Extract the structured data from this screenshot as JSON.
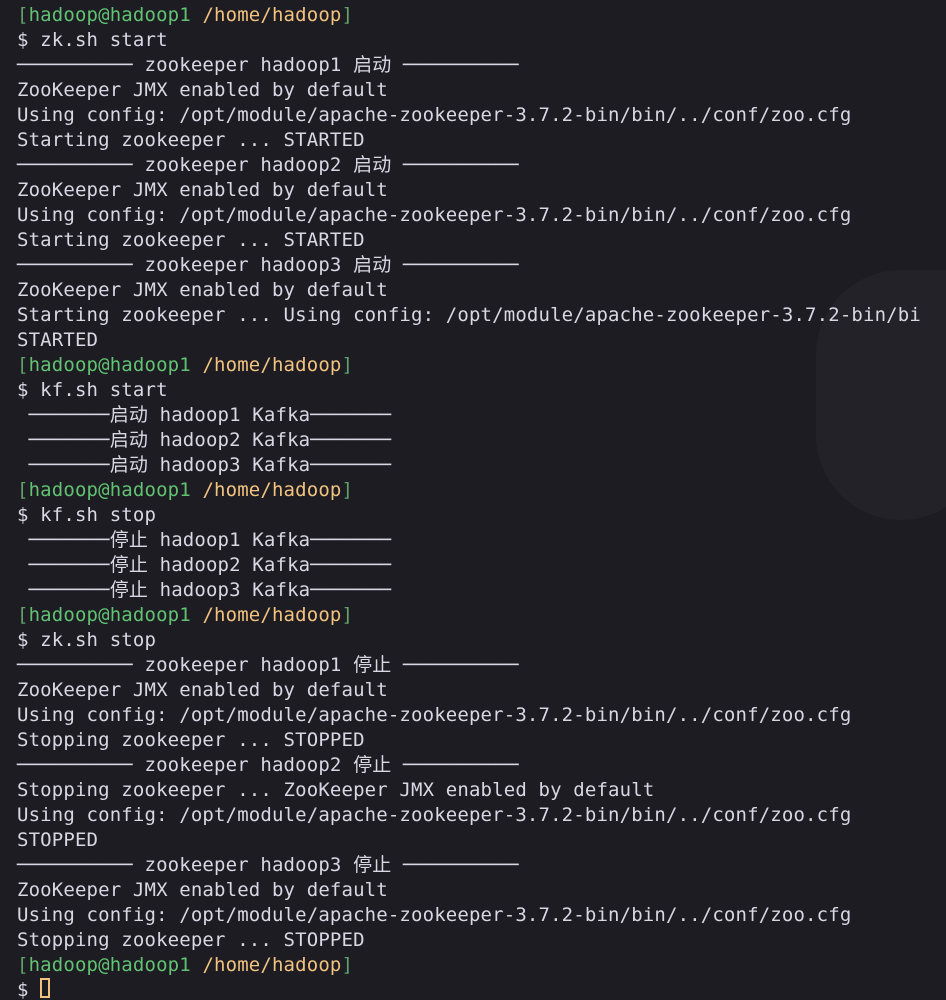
{
  "terminal": {
    "lines": [
      {
        "type": "prompt",
        "bracket_open": "[",
        "user": "hadoop@hadoop1",
        "path": "/home/hadoop",
        "bracket_close": "]"
      },
      {
        "type": "text",
        "text": "$ zk.sh start"
      },
      {
        "type": "text",
        "text": "────────── zookeeper hadoop1 启动 ──────────"
      },
      {
        "type": "text",
        "text": "ZooKeeper JMX enabled by default"
      },
      {
        "type": "text",
        "text": "Using config: /opt/module/apache-zookeeper-3.7.2-bin/bin/../conf/zoo.cfg"
      },
      {
        "type": "text",
        "text": "Starting zookeeper ... STARTED"
      },
      {
        "type": "text",
        "text": "────────── zookeeper hadoop2 启动 ──────────"
      },
      {
        "type": "text",
        "text": "ZooKeeper JMX enabled by default"
      },
      {
        "type": "text",
        "text": "Using config: /opt/module/apache-zookeeper-3.7.2-bin/bin/../conf/zoo.cfg"
      },
      {
        "type": "text",
        "text": "Starting zookeeper ... STARTED"
      },
      {
        "type": "text",
        "text": "────────── zookeeper hadoop3 启动 ──────────"
      },
      {
        "type": "text",
        "text": "ZooKeeper JMX enabled by default"
      },
      {
        "type": "text",
        "text": "Starting zookeeper ... Using config: /opt/module/apache-zookeeper-3.7.2-bin/bi"
      },
      {
        "type": "text",
        "text": "STARTED"
      },
      {
        "type": "prompt",
        "bracket_open": "[",
        "user": "hadoop@hadoop1",
        "path": "/home/hadoop",
        "bracket_close": "]"
      },
      {
        "type": "text",
        "text": "$ kf.sh start"
      },
      {
        "type": "text",
        "text": " ───────启动 hadoop1 Kafka───────"
      },
      {
        "type": "text",
        "text": " ───────启动 hadoop2 Kafka───────"
      },
      {
        "type": "text",
        "text": " ───────启动 hadoop3 Kafka───────"
      },
      {
        "type": "prompt",
        "bracket_open": "[",
        "user": "hadoop@hadoop1",
        "path": "/home/hadoop",
        "bracket_close": "]"
      },
      {
        "type": "text",
        "text": "$ kf.sh stop"
      },
      {
        "type": "text",
        "text": " ───────停止 hadoop1 Kafka───────"
      },
      {
        "type": "text",
        "text": " ───────停止 hadoop2 Kafka───────"
      },
      {
        "type": "text",
        "text": " ───────停止 hadoop3 Kafka───────"
      },
      {
        "type": "prompt",
        "bracket_open": "[",
        "user": "hadoop@hadoop1",
        "path": "/home/hadoop",
        "bracket_close": "]"
      },
      {
        "type": "text",
        "text": "$ zk.sh stop"
      },
      {
        "type": "text",
        "text": "────────── zookeeper hadoop1 停止 ──────────"
      },
      {
        "type": "text",
        "text": "ZooKeeper JMX enabled by default"
      },
      {
        "type": "text",
        "text": "Using config: /opt/module/apache-zookeeper-3.7.2-bin/bin/../conf/zoo.cfg"
      },
      {
        "type": "text",
        "text": "Stopping zookeeper ... STOPPED"
      },
      {
        "type": "text",
        "text": "────────── zookeeper hadoop2 停止 ──────────"
      },
      {
        "type": "text",
        "text": "Stopping zookeeper ... ZooKeeper JMX enabled by default"
      },
      {
        "type": "text",
        "text": "Using config: /opt/module/apache-zookeeper-3.7.2-bin/bin/../conf/zoo.cfg"
      },
      {
        "type": "text",
        "text": "STOPPED"
      },
      {
        "type": "text",
        "text": "────────── zookeeper hadoop3 停止 ──────────"
      },
      {
        "type": "text",
        "text": "ZooKeeper JMX enabled by default"
      },
      {
        "type": "text",
        "text": "Using config: /opt/module/apache-zookeeper-3.7.2-bin/bin/../conf/zoo.cfg"
      },
      {
        "type": "text",
        "text": "Stopping zookeeper ... STOPPED"
      },
      {
        "type": "prompt",
        "bracket_open": "[",
        "user": "hadoop@hadoop1",
        "path": "/home/hadoop",
        "bracket_close": "]"
      },
      {
        "type": "text",
        "text": "$ "
      }
    ],
    "colors": {
      "background": "#1d1c23",
      "text": "#d9d7e3",
      "prompt_user": "#61c372",
      "prompt_path": "#f2c37f",
      "cursor": "#f2c37f"
    }
  }
}
